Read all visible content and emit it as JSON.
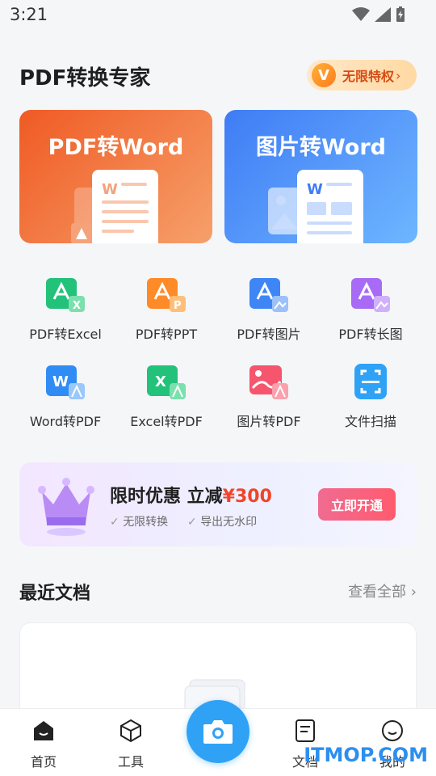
{
  "status_bar": {
    "time": "3:21"
  },
  "header": {
    "title": "PDF转换专家",
    "vip_badge": "V",
    "vip_label": "无限特权"
  },
  "feature_cards": [
    {
      "title": "PDF转Word",
      "doc_letter": "W"
    },
    {
      "title": "图片转Word",
      "doc_letter": "W"
    }
  ],
  "tools": [
    {
      "label": "PDF转Excel",
      "badge": "X",
      "color": "#22c27a"
    },
    {
      "label": "PDF转PPT",
      "badge": "P",
      "color": "#ff8a28"
    },
    {
      "label": "PDF转图片",
      "badge": "",
      "color": "#3e86f5"
    },
    {
      "label": "PDF转长图",
      "badge": "",
      "color": "#a86bf5"
    },
    {
      "label": "Word转PDF",
      "badge": "W",
      "color": "#2f8cf5"
    },
    {
      "label": "Excel转PDF",
      "badge": "X",
      "color": "#22c27a"
    },
    {
      "label": "图片转PDF",
      "badge": "",
      "color": "#f5566d"
    },
    {
      "label": "文件扫描",
      "badge": "",
      "color": "#2fa2f6"
    }
  ],
  "promo": {
    "title": "限时优惠 立减",
    "price": "¥300",
    "features": [
      "无限转换",
      "导出无水印"
    ],
    "button": "立即开通"
  },
  "recent": {
    "title": "最近文档",
    "view_all": "查看全部"
  },
  "tabbar": {
    "items": [
      {
        "label": "首页",
        "active": true
      },
      {
        "label": "工具",
        "active": false
      },
      {
        "label": "文档",
        "active": false
      },
      {
        "label": "我的",
        "active": false
      }
    ]
  },
  "watermark": "ITMOP.COM"
}
